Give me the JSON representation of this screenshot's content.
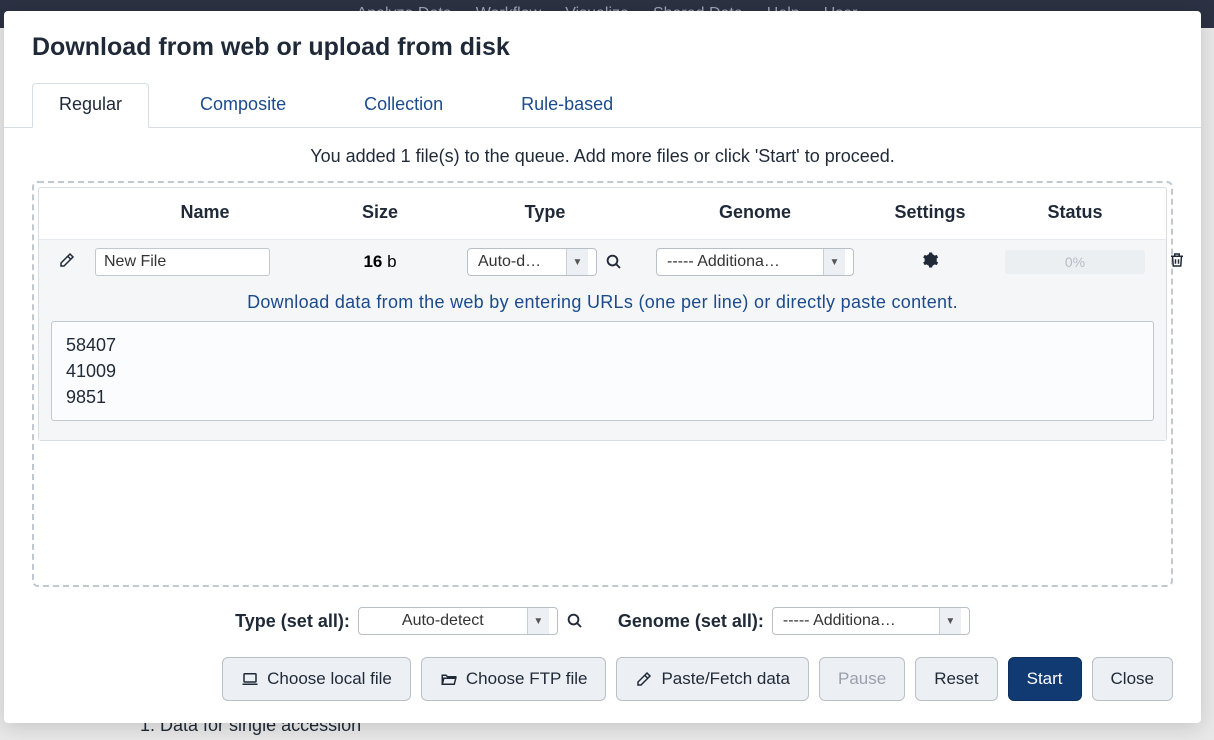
{
  "topnav": {
    "analyze": "Analyze Data",
    "workflow": "Workflow",
    "visualize": "Visualize",
    "shared": "Shared Data",
    "help": "Help",
    "user": "User"
  },
  "bg": {
    "list_item": "Data for single accession"
  },
  "modal": {
    "title": "Download from web or upload from disk",
    "tabs": {
      "regular": "Regular",
      "composite": "Composite",
      "collection": "Collection",
      "rule": "Rule-based"
    },
    "info": "You added 1 file(s) to the queue. Add more files or click 'Start' to proceed.",
    "headers": {
      "name": "Name",
      "size": "Size",
      "type": "Type",
      "genome": "Genome",
      "settings": "Settings",
      "status": "Status"
    },
    "row": {
      "name": "New File",
      "size_num": "16",
      "size_unit": " b",
      "type": "Auto-d…",
      "genome": "----- Additiona…",
      "progress": "0%"
    },
    "paste_hint": "Download data from the web by entering URLs (one per line) or directly paste content.",
    "paste_content": "58407\n41009\n9851",
    "set_all": {
      "type_label": "Type (set all):",
      "type_value": "Auto-detect",
      "genome_label": "Genome (set all):",
      "genome_value": "----- Additiona…"
    },
    "buttons": {
      "choose_local": "Choose local file",
      "choose_ftp": "Choose FTP file",
      "paste_fetch": "Paste/Fetch data",
      "pause": "Pause",
      "reset": "Reset",
      "start": "Start",
      "close": "Close"
    }
  }
}
